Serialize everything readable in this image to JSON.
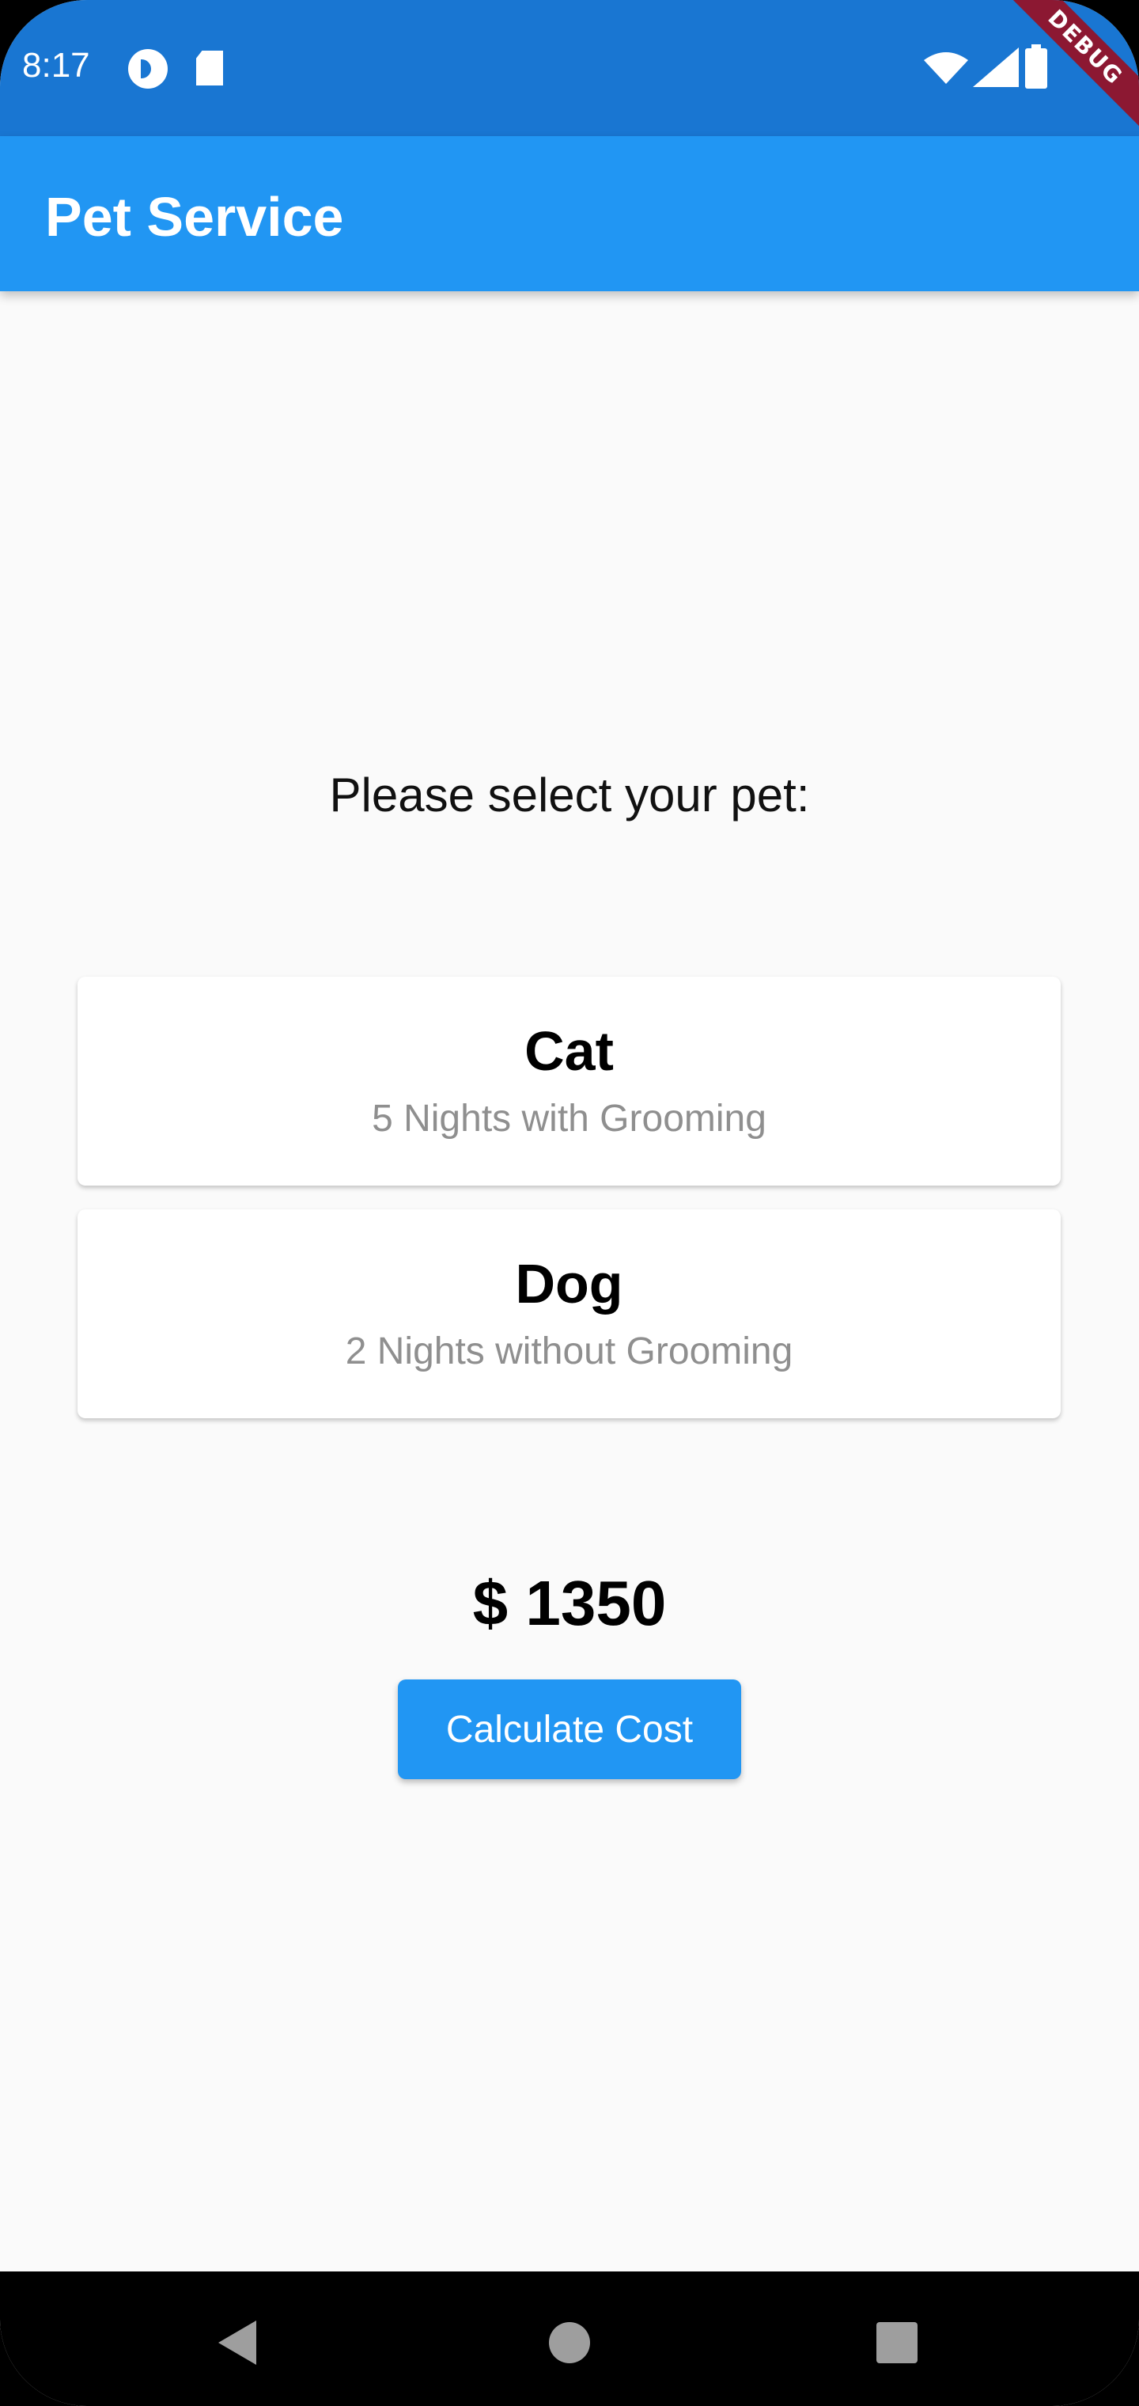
{
  "status_bar": {
    "time": "8:17",
    "icons": [
      "privacy-indicator-icon",
      "sd-card-icon",
      "wifi-icon",
      "signal-icon",
      "battery-icon"
    ]
  },
  "debug_banner": "DEBUG",
  "app_bar": {
    "title": "Pet Service",
    "color": "#2196f3"
  },
  "main": {
    "prompt": "Please select your pet:",
    "pets": [
      {
        "name": "Cat",
        "detail": "5 Nights with Grooming"
      },
      {
        "name": "Dog",
        "detail": "2 Nights without Grooming"
      }
    ],
    "cost": "$ 1350",
    "calculate_button": "Calculate Cost"
  },
  "nav_bar": {
    "icons": [
      "back-icon",
      "home-icon",
      "recents-icon"
    ]
  },
  "colors": {
    "status_bar": "#1976d2",
    "accent": "#2196f3",
    "debug": "#8c1832"
  }
}
